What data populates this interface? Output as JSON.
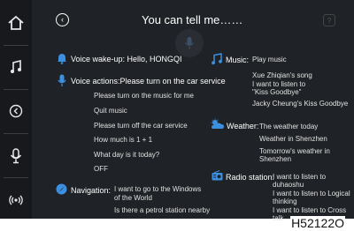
{
  "header": {
    "title": "You can tell me……"
  },
  "sidebar": {
    "items": [
      "home-icon",
      "music-note-icon",
      "back-icon",
      "microphone-icon",
      "radio-icon"
    ]
  },
  "left": {
    "wakeup": {
      "label": "Voice wake-up: Hello, HONGQI"
    },
    "actions": {
      "label": "Voice actions:Please turn on the car service",
      "phrases": [
        "Please turn on the music for me",
        "Quit music",
        "Please turn off the car service",
        "How much is 1 + 1",
        "What day is it today?",
        "OFF"
      ]
    },
    "navigation": {
      "label": "Navigation:",
      "phrases": [
        "I want to go to the Windows",
        "of the World",
        "Is there a petrol station nearby"
      ]
    }
  },
  "right": {
    "music": {
      "label": "Music:",
      "phrases": [
        "Play music",
        "Xue Zhiqian's song",
        "I want to listen to",
        "\"Kiss Goodbye\"",
        "Jacky Cheung's Kiss Goodbye"
      ]
    },
    "weather": {
      "label": "Weather:",
      "phrases": [
        "The weather today",
        "Weather in Shenzhen",
        "Tomorrow's weather in",
        "Shenzhen"
      ]
    },
    "radio": {
      "label": "Radio station:",
      "phrases": [
        "I want to listen to",
        "duhaoshu",
        "I want to listen to Logical",
        "thinking",
        "I want to listen to Cross",
        "talk"
      ]
    }
  },
  "caption": "H52122O",
  "colors": {
    "accent": "#3d8fe0",
    "background": "#1f2226",
    "sidebar": "#17191c"
  }
}
